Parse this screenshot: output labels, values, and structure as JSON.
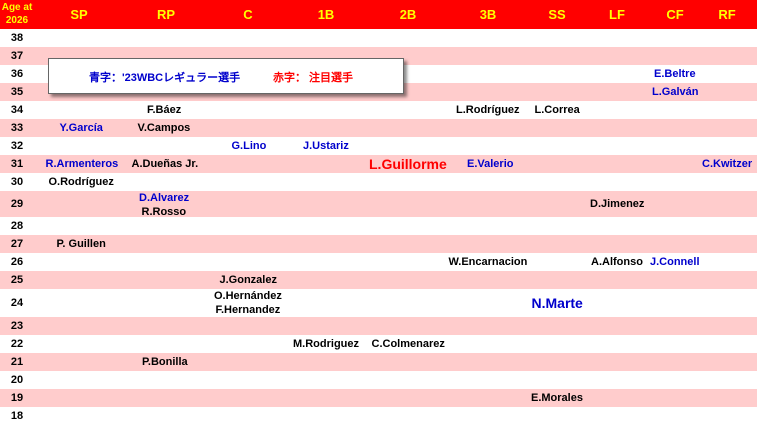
{
  "header": {
    "age_label_top": "Age at",
    "age_label_bottom": "2026",
    "positions": [
      "SP",
      "RP",
      "C",
      "1B",
      "2B",
      "3B",
      "SS",
      "LF",
      "CF",
      "RF"
    ]
  },
  "legend": {
    "blue_label": "青字：'23WBCレギュラー選手",
    "red_label": "赤字： 注目選手"
  },
  "colors": {
    "header_bg": "#ff0000",
    "header_text": "#ffff00",
    "row_pink": "#ffcccc",
    "blue_text": "#0000cc",
    "red_text": "#ff0000"
  },
  "rows": [
    {
      "age": "38",
      "players": []
    },
    {
      "age": "37",
      "players": []
    },
    {
      "age": "36",
      "players": [
        {
          "name": "E.Beltre",
          "pos": "CF",
          "color": "blue"
        }
      ]
    },
    {
      "age": "35",
      "players": [
        {
          "name": "L.Galván",
          "pos": "CF",
          "color": "blue"
        }
      ]
    },
    {
      "age": "34",
      "players": [
        {
          "name": "F.Báez",
          "pos": "RP",
          "color": "black"
        },
        {
          "name": "L.Rodríguez",
          "pos": "3B",
          "color": "black"
        },
        {
          "name": "L.Correa",
          "pos": "SS",
          "color": "black"
        }
      ]
    },
    {
      "age": "33",
      "players": [
        {
          "name": "Y.García",
          "pos": "SP",
          "color": "blue"
        },
        {
          "name": "V.Campos",
          "pos": "RP",
          "color": "black"
        }
      ]
    },
    {
      "age": "32",
      "players": [
        {
          "name": "G.Lino",
          "pos": "C",
          "color": "blue"
        },
        {
          "name": "J.Ustariz",
          "pos": "1B",
          "color": "blue"
        }
      ]
    },
    {
      "age": "31",
      "players": [
        {
          "name": "R.Armenteros",
          "pos": "SP",
          "color": "blue"
        },
        {
          "name": "A.Dueñas Jr.",
          "pos": "RP",
          "color": "black"
        },
        {
          "name": "L.Guillorme",
          "pos": "2B",
          "color": "red",
          "big": true
        },
        {
          "name": "E.Valerio",
          "pos": "3B",
          "color": "blue"
        },
        {
          "name": "C.Kwitzer",
          "pos": "RF",
          "color": "blue"
        }
      ]
    },
    {
      "age": "30",
      "players": [
        {
          "name": "O.Rodríguez",
          "pos": "SP",
          "color": "black"
        }
      ]
    },
    {
      "age": "29",
      "players": [
        {
          "name": "D.Alvarez",
          "pos": "RP",
          "color": "blue",
          "line": 0
        },
        {
          "name": "R.Rosso",
          "pos": "RP",
          "color": "black",
          "line": 1
        },
        {
          "name": "D.Jimenez",
          "pos": "LF",
          "color": "black"
        }
      ]
    },
    {
      "age": "28",
      "players": []
    },
    {
      "age": "27",
      "players": [
        {
          "name": "P. Guillen",
          "pos": "SP",
          "color": "black"
        }
      ]
    },
    {
      "age": "26",
      "players": [
        {
          "name": "W.Encarnacion",
          "pos": "3B",
          "color": "black"
        },
        {
          "name": "A.Alfonso",
          "pos": "LF",
          "color": "black"
        },
        {
          "name": "J.Connell",
          "pos": "CF",
          "color": "blue"
        }
      ]
    },
    {
      "age": "25",
      "players": [
        {
          "name": "J.Gonzalez",
          "pos": "C",
          "color": "black"
        }
      ]
    },
    {
      "age": "24",
      "players": [
        {
          "name": "O.Hernández",
          "pos": "C",
          "color": "black",
          "line": 0
        },
        {
          "name": "F.Hernandez",
          "pos": "C",
          "color": "black",
          "line": 1
        },
        {
          "name": "N.Marte",
          "pos": "SS",
          "color": "blue",
          "big": true
        }
      ]
    },
    {
      "age": "23",
      "players": []
    },
    {
      "age": "22",
      "players": [
        {
          "name": "M.Rodriguez",
          "pos": "1B",
          "color": "black"
        },
        {
          "name": "C.Colmenarez",
          "pos": "2B",
          "color": "black"
        }
      ]
    },
    {
      "age": "21",
      "players": [
        {
          "name": "P.Bonilla",
          "pos": "RP",
          "color": "black"
        }
      ]
    },
    {
      "age": "20",
      "players": []
    },
    {
      "age": "19",
      "players": [
        {
          "name": "E.Morales",
          "pos": "SS",
          "color": "black"
        }
      ]
    },
    {
      "age": "18",
      "players": []
    }
  ]
}
